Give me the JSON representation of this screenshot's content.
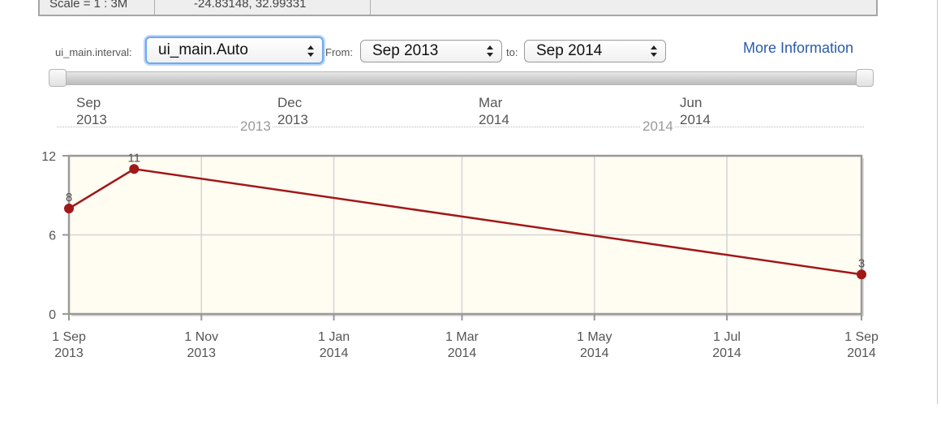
{
  "info_table": {
    "scale_text": "Scale = 1 : 3M",
    "coords_text": "-24.83148, 32.99331"
  },
  "controls": {
    "interval_label": "ui_main.interval:",
    "interval_value": "ui_main.Auto",
    "from_label": "From:",
    "from_value": "Sep 2013",
    "to_label": "to:",
    "to_value": "Sep 2014",
    "more_info": "More Information"
  },
  "slider": {
    "start_fraction": 0,
    "end_fraction": 1
  },
  "timeline": {
    "month_labels": [
      {
        "month": "Sep",
        "year": "2013"
      },
      {
        "month": "Dec",
        "year": "2013"
      },
      {
        "month": "Mar",
        "year": "2014"
      },
      {
        "month": "Jun",
        "year": "2014"
      }
    ],
    "year_markers": [
      "2013",
      "2014"
    ]
  },
  "colors": {
    "series": "#a01818",
    "plot_bg": "#fffcf2",
    "grid": "#d4d4d4",
    "frame": "#999999",
    "link": "#2a5ca8",
    "focus": "#6fa8ef"
  },
  "chart_data": {
    "type": "line",
    "title": "",
    "xlabel": "",
    "ylabel": "",
    "ylim": [
      0,
      12
    ],
    "yticks": [
      0,
      6,
      12
    ],
    "xlim": [
      "2013-09-01",
      "2014-09-01"
    ],
    "x_ticks": [
      {
        "date": "2013-09-01",
        "line1": "1 Sep",
        "line2": "2013"
      },
      {
        "date": "2013-11-01",
        "line1": "1 Nov",
        "line2": "2013"
      },
      {
        "date": "2014-01-01",
        "line1": "1 Jan",
        "line2": "2014"
      },
      {
        "date": "2014-03-01",
        "line1": "1 Mar",
        "line2": "2014"
      },
      {
        "date": "2014-05-01",
        "line1": "1 May",
        "line2": "2014"
      },
      {
        "date": "2014-07-01",
        "line1": "1 Jul",
        "line2": "2014"
      },
      {
        "date": "2014-09-01",
        "line1": "1 Sep",
        "line2": "2014"
      }
    ],
    "grid": true,
    "series": [
      {
        "points": [
          {
            "x": "2013-09-01",
            "y": 8,
            "label": "8"
          },
          {
            "x": "2013-10-01",
            "y": 11,
            "label": "11"
          },
          {
            "x": "2014-09-01",
            "y": 3,
            "label": "3"
          }
        ]
      }
    ]
  }
}
